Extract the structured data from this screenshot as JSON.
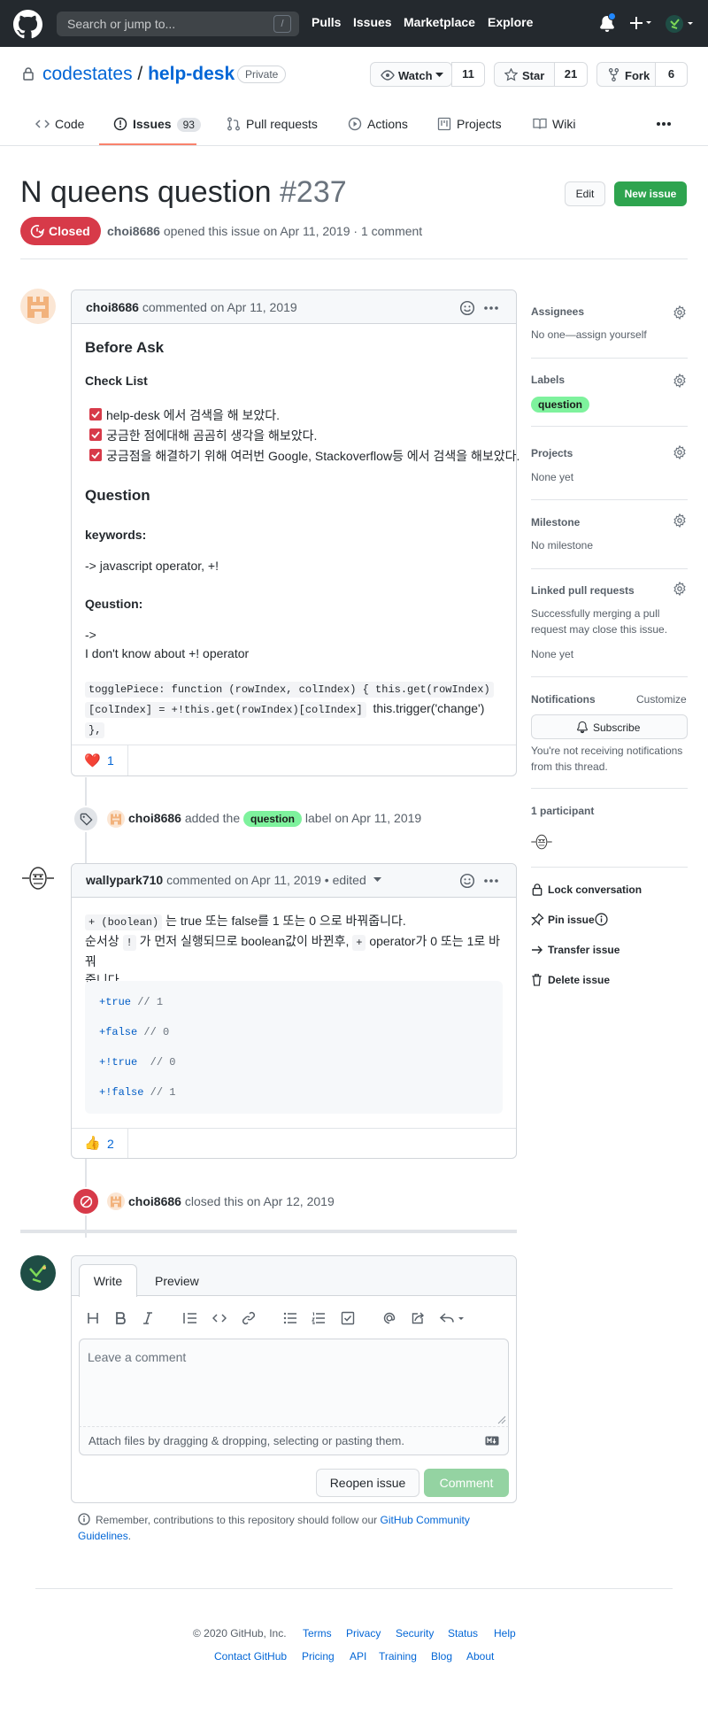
{
  "header": {
    "search_placeholder": "Search or jump to...",
    "slash_key": "/",
    "nav": [
      "Pulls",
      "Issues",
      "Marketplace",
      "Explore"
    ]
  },
  "repo": {
    "owner": "codestates",
    "separator": "/",
    "name": "help-desk",
    "visibility": "Private",
    "watch_label": "Watch",
    "watch_count": "11",
    "star_label": "Star",
    "star_count": "21",
    "fork_label": "Fork",
    "fork_count": "6"
  },
  "tabs": [
    {
      "label": "Code"
    },
    {
      "label": "Issues",
      "count": "93"
    },
    {
      "label": "Pull requests"
    },
    {
      "label": "Actions"
    },
    {
      "label": "Projects"
    },
    {
      "label": "Wiki"
    }
  ],
  "issue": {
    "title": "N queens question",
    "number": "#237",
    "state": "Closed",
    "author": "choi8686",
    "meta": "opened this issue on Apr 11, 2019 · 1 comment",
    "edit_label": "Edit",
    "new_issue_label": "New issue"
  },
  "comment1": {
    "author": "choi8686",
    "action": "commented on Apr 11, 2019",
    "h_before": "Before Ask",
    "h_checklist": "Check List",
    "checks": [
      "help-desk 에서 검색을 해 보았다.",
      "궁금한 점에대해 곰곰히 생각을 해보았다.",
      "궁금점을 해결하기 위해 여러번 Google, Stackoverflow등 에서 검색을 해보았다."
    ],
    "h_question": "Question",
    "keywords_label": "keywords:",
    "keywords_text": "-> javascript operator, +!",
    "qustion_label": "Qeustion:",
    "arrow": "->",
    "question_text": "I don't know about +! operator",
    "code_line1": "togglePiece: function (rowIndex, colIndex) { this.get(rowIndex)",
    "code_line2": "[colIndex] = +!this.get(rowIndex)[colIndex]",
    "code_line2_tail": "this.trigger('change')",
    "code_line3": "},",
    "reaction_emoji": "❤️",
    "reaction_count": "1"
  },
  "event_label": {
    "author": "choi8686",
    "pre": "added the",
    "label": "question",
    "post": "label on Apr 11, 2019"
  },
  "comment2": {
    "author": "wallypark710",
    "action": "commented on Apr 11, 2019 • edited",
    "line1_code": "+ (boolean)",
    "line1_text": "는 true 또는 false를 1 또는 0 으로 바꿔줍니다.",
    "line2_pre": "순서상",
    "line2_code": "!",
    "line2_mid": "가 먼저 실행되므로 boolean값이 바뀐후,",
    "line2_code2": "+",
    "line2_post": "operator가 0 또는 1로 바꿔",
    "line3": "줍니다.",
    "code_block": [
      {
        "expr": "+true",
        "comment": "// 1"
      },
      {
        "expr": "+false",
        "comment": "// 0"
      },
      {
        "expr": "+!true",
        "comment": " // 0"
      },
      {
        "expr": "+!false",
        "comment": "// 1"
      }
    ],
    "reaction_emoji": "👍",
    "reaction_count": "2"
  },
  "event_closed": {
    "author": "choi8686",
    "text": "closed this on Apr 12, 2019"
  },
  "composer": {
    "tab_write": "Write",
    "tab_preview": "Preview",
    "placeholder": "Leave a comment",
    "attach_text": "Attach files by dragging & dropping, selecting or pasting them.",
    "reopen_label": "Reopen issue",
    "comment_label": "Comment",
    "notice_pre": "Remember, contributions to this repository should follow our",
    "notice_link1": "GitHub Community",
    "notice_link2": "Guidelines",
    "notice_period": "."
  },
  "sidebar": {
    "assignees_h": "Assignees",
    "assignees_v": "No one—assign yourself",
    "labels_h": "Labels",
    "label_name": "question",
    "projects_h": "Projects",
    "projects_v": "None yet",
    "milestone_h": "Milestone",
    "milestone_v": "No milestone",
    "linked_h": "Linked pull requests",
    "linked_desc1": "Successfully merging a pull",
    "linked_desc2": "request may close this issue.",
    "linked_v": "None yet",
    "notif_h": "Notifications",
    "customize": "Customize",
    "subscribe": "Subscribe",
    "notif_desc1": "You're not receiving notifications",
    "notif_desc2": "from this thread.",
    "participants_h": "1 participant",
    "lock": "Lock conversation",
    "pin": "Pin issue",
    "transfer": "Transfer issue",
    "delete": "Delete issue"
  },
  "footer": {
    "copyright": "© 2020 GitHub, Inc.",
    "row1": [
      "Terms",
      "Privacy",
      "Security",
      "Status",
      "Help"
    ],
    "row2": [
      "Contact GitHub",
      "Pricing",
      "API",
      "Training",
      "Blog",
      "About"
    ]
  },
  "colors": {
    "header_bg": "#24292e",
    "closed_red": "#d73a49",
    "green": "#2ea44f",
    "label_green": "#7ef29d",
    "link_blue": "#0366d6",
    "tab_underline": "#f9826c"
  }
}
